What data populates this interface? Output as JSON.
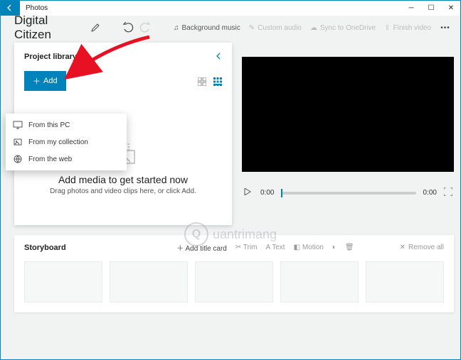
{
  "window": {
    "title": "Photos"
  },
  "project": {
    "title": "Digital Citizen"
  },
  "toolbar": {
    "bg_music": "Background music",
    "custom_audio": "Custom audio",
    "sync": "Sync to OneDrive",
    "finish": "Finish video"
  },
  "library": {
    "heading": "Project library",
    "add_label": "Add",
    "empty_title": "Add media to get started now",
    "empty_sub": "Drag photos and video clips here, or click Add."
  },
  "add_menu": {
    "from_pc": "From this PC",
    "from_collection": "From my collection",
    "from_web": "From the web"
  },
  "player": {
    "current": "0:00",
    "total": "0:00"
  },
  "storyboard": {
    "title": "Storyboard",
    "add_title_card": "Add title card",
    "trim": "Trim",
    "text": "Text",
    "motion": "Motion",
    "remove_all": "Remove all"
  },
  "watermark": "uantrimang"
}
